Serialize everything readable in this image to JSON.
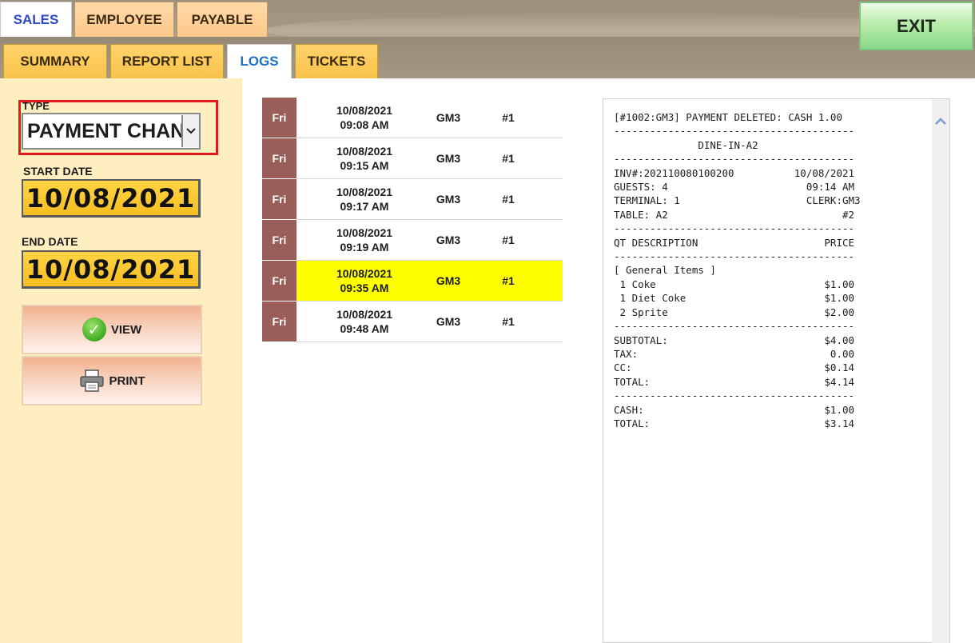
{
  "top_tabs": [
    {
      "label": "SALES",
      "active": true
    },
    {
      "label": "EMPLOYEE",
      "active": false
    },
    {
      "label": "PAYABLE",
      "active": false
    }
  ],
  "sub_tabs": [
    {
      "label": "SUMMARY",
      "active": false
    },
    {
      "label": "REPORT LIST",
      "active": false
    },
    {
      "label": "LOGS",
      "active": true
    },
    {
      "label": "TICKETS",
      "active": false
    }
  ],
  "exit_label": "EXIT",
  "filters": {
    "type_label": "TYPE",
    "type_value": "PAYMENT CHANGE",
    "start_label": "START DATE",
    "start_value": "10/08/2021",
    "end_label": "END DATE",
    "end_value": "10/08/2021",
    "view_label": "VIEW",
    "print_label": "PRINT"
  },
  "logs": [
    {
      "day": "Fri",
      "date": "10/08/2021",
      "time": "09:08 AM",
      "clerk": "GM3",
      "num": "#1"
    },
    {
      "day": "Fri",
      "date": "10/08/2021",
      "time": "09:15 AM",
      "clerk": "GM3",
      "num": "#1"
    },
    {
      "day": "Fri",
      "date": "10/08/2021",
      "time": "09:17 AM",
      "clerk": "GM3",
      "num": "#1"
    },
    {
      "day": "Fri",
      "date": "10/08/2021",
      "time": "09:19 AM",
      "clerk": "GM3",
      "num": "#1"
    },
    {
      "day": "Fri",
      "date": "10/08/2021",
      "time": "09:35 AM",
      "clerk": "GM3",
      "num": "#1",
      "selected": true
    },
    {
      "day": "Fri",
      "date": "10/08/2021",
      "time": "09:48 AM",
      "clerk": "GM3",
      "num": "#1"
    }
  ],
  "receipt_lines": [
    "[#1002:GM3] PAYMENT DELETED: CASH 1.00",
    "----------------------------------------",
    "              DINE-IN-A2",
    "----------------------------------------",
    "INV#:202110080100200          10/08/2021",
    "GUESTS: 4                       09:14 AM",
    "TERMINAL: 1                     CLERK:GM3",
    "TABLE: A2                             #2",
    "----------------------------------------",
    "QT DESCRIPTION                     PRICE",
    "----------------------------------------",
    "[ General Items ]",
    " 1 Coke                            $1.00",
    " 1 Diet Coke                       $1.00",
    " 2 Sprite                          $2.00",
    "----------------------------------------",
    "SUBTOTAL:                          $4.00",
    "TAX:                                0.00",
    "CC:                                $0.14",
    "TOTAL:                             $4.14",
    "----------------------------------------",
    "CASH:                              $1.00",
    "TOTAL:                             $3.14"
  ]
}
